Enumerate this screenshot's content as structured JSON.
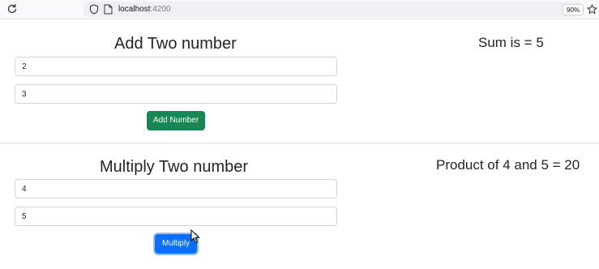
{
  "browser": {
    "url_host": "localhost",
    "url_port": ":4200",
    "zoom_level": "90%"
  },
  "add_section": {
    "heading": "Add Two number",
    "input1_value": "2",
    "input2_value": "3",
    "button_label": "Add Number",
    "button_color": "#198754",
    "result_text": "Sum is = 5"
  },
  "multiply_section": {
    "heading": "Multiply Two number",
    "input1_value": "4",
    "input2_value": "5",
    "button_label": "Multiply",
    "button_color": "#0d6efd",
    "result_text": "Product of 4 and 5 = 20"
  },
  "icons": [
    "reload-icon",
    "shield-icon",
    "page-icon",
    "star-icon",
    "mouse-cursor-icon"
  ]
}
